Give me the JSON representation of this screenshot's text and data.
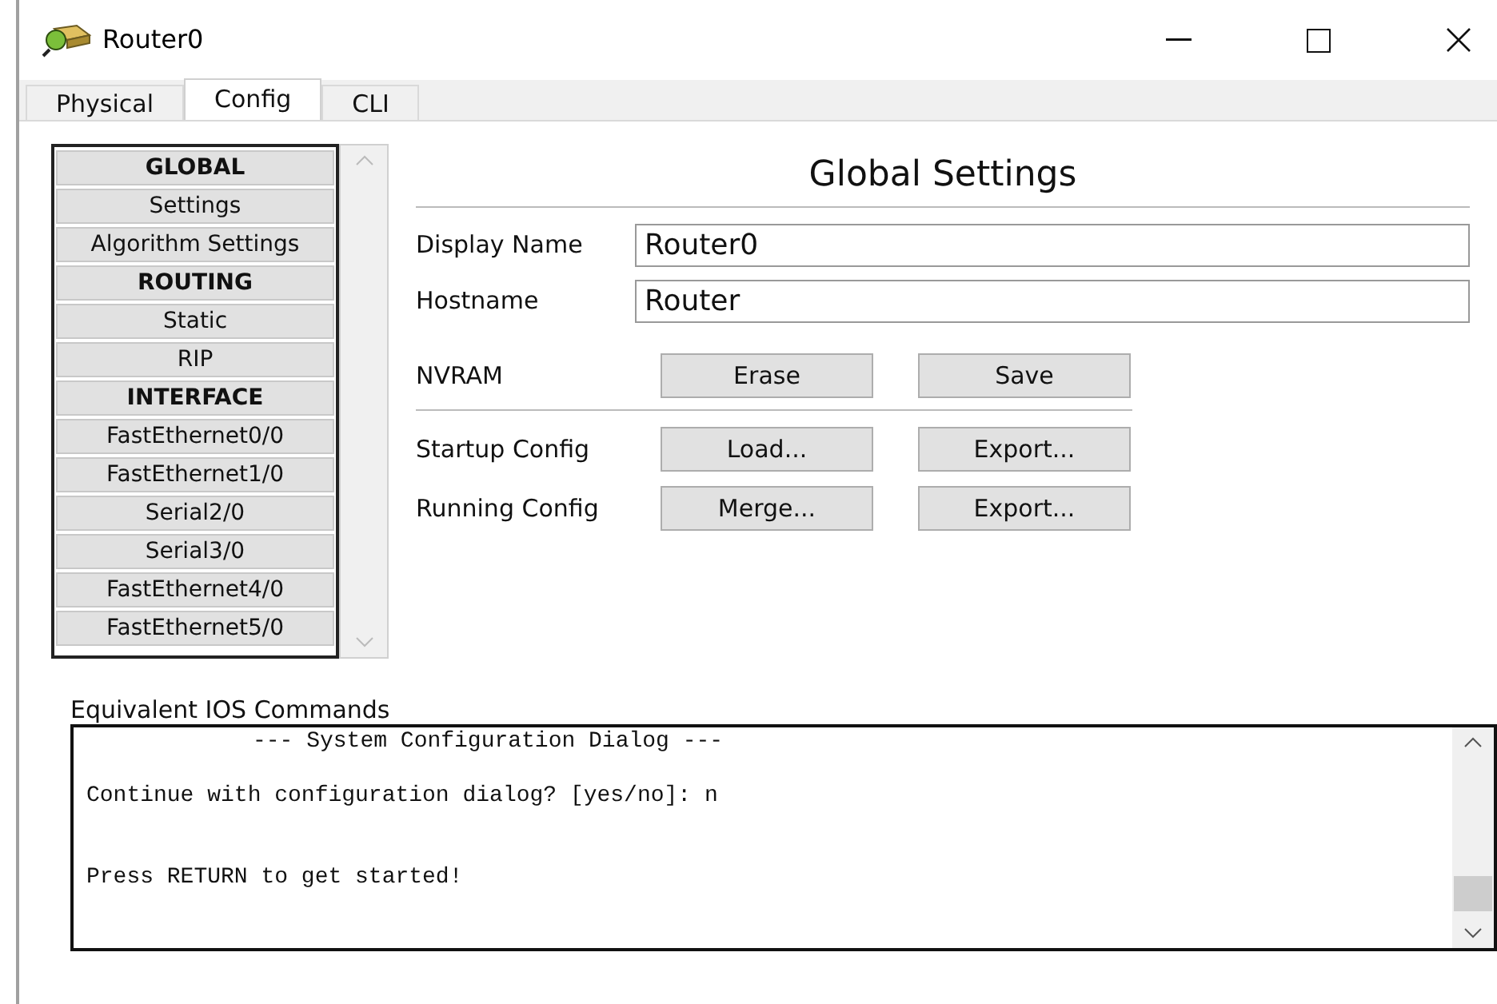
{
  "window": {
    "title": "Router0"
  },
  "tabs": [
    {
      "label": "Physical",
      "selected": false
    },
    {
      "label": "Config",
      "selected": true
    },
    {
      "label": "CLI",
      "selected": false
    }
  ],
  "sidebar": {
    "items": [
      {
        "label": "GLOBAL",
        "kind": "header"
      },
      {
        "label": "Settings",
        "kind": "item"
      },
      {
        "label": "Algorithm Settings",
        "kind": "item"
      },
      {
        "label": "ROUTING",
        "kind": "header"
      },
      {
        "label": "Static",
        "kind": "item"
      },
      {
        "label": "RIP",
        "kind": "item"
      },
      {
        "label": "INTERFACE",
        "kind": "header"
      },
      {
        "label": "FastEthernet0/0",
        "kind": "item"
      },
      {
        "label": "FastEthernet1/0",
        "kind": "item"
      },
      {
        "label": "Serial2/0",
        "kind": "item"
      },
      {
        "label": "Serial3/0",
        "kind": "item"
      },
      {
        "label": "FastEthernet4/0",
        "kind": "item"
      },
      {
        "label": "FastEthernet5/0",
        "kind": "item"
      }
    ]
  },
  "panel": {
    "title": "Global Settings",
    "fields": [
      {
        "label": "Display Name",
        "value": "Router0"
      },
      {
        "label": "Hostname",
        "value": "Router"
      }
    ],
    "nvram": {
      "label": "NVRAM",
      "buttons": [
        "Erase",
        "Save"
      ]
    },
    "configs": [
      {
        "label": "Startup Config",
        "buttons": [
          "Load...",
          "Export..."
        ]
      },
      {
        "label": "Running Config",
        "buttons": [
          "Merge...",
          "Export..."
        ]
      }
    ]
  },
  "console": {
    "label": "Equivalent IOS Commands",
    "lines": [
      "--- System Configuration Dialog ---",
      "Continue with configuration dialog? [yes/no]: n",
      "Press RETURN to get started!"
    ]
  }
}
